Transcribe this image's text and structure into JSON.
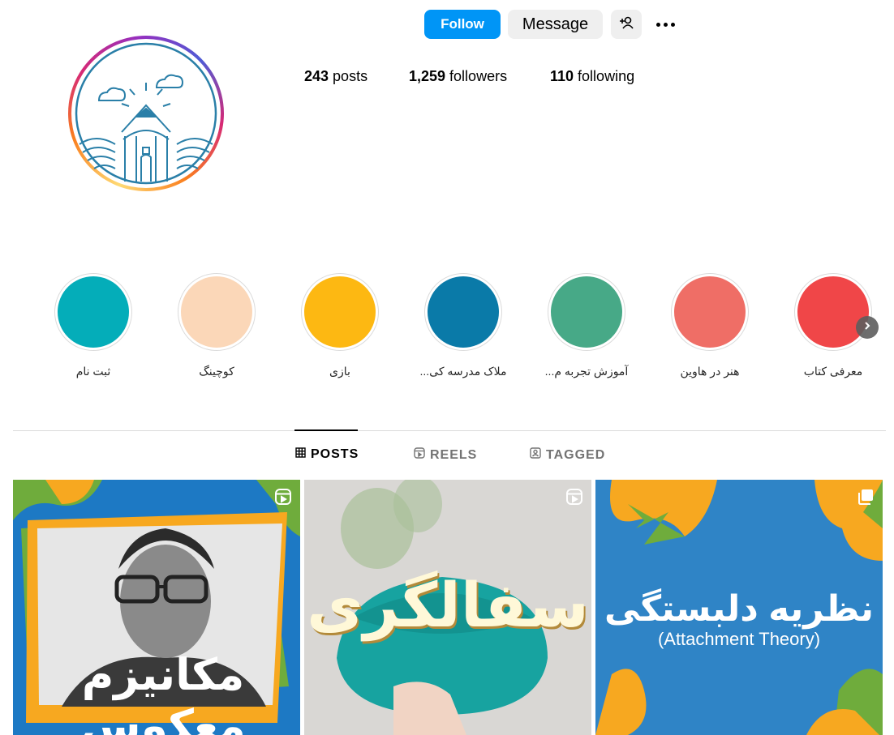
{
  "header": {
    "follow_label": "Follow",
    "message_label": "Message",
    "add_user_icon": "add-user-icon",
    "more_icon": "more-options-icon"
  },
  "stats": {
    "posts_count": "243",
    "posts_label": " posts",
    "followers_count": "1,259",
    "followers_label": " followers",
    "following_count": "110",
    "following_label": " following"
  },
  "highlights": [
    {
      "label": "ثبت نام",
      "color": "#04adb9"
    },
    {
      "label": "کوچینگ",
      "color": "#fbd7b8"
    },
    {
      "label": "بازی",
      "color": "#fdb812"
    },
    {
      "label": "ملاک مدرسه کی...",
      "color": "#0a7aa8"
    },
    {
      "label": "آموزش تجربه م...",
      "color": "#47a987"
    },
    {
      "label": "هنر در هاوین",
      "color": "#ef6e66"
    },
    {
      "label": "معرفی کتاب",
      "color": "#f04648"
    }
  ],
  "tabs": {
    "posts": "POSTS",
    "reels": "REELS",
    "tagged": "TAGGED"
  },
  "posts": [
    {
      "type": "reel",
      "title_text": "مکانیزم معکوس",
      "bg": "#1d79c4"
    },
    {
      "type": "reel",
      "title_text": "سفالگری",
      "bg": "#d9d7d4"
    },
    {
      "type": "carousel",
      "title_text": "نظریه دلبستگی",
      "subtitle_text": "(Attachment Theory)",
      "bg": "#2f84c6"
    }
  ],
  "colors": {
    "accent": "#0095f6",
    "button_gray": "#efefef"
  }
}
